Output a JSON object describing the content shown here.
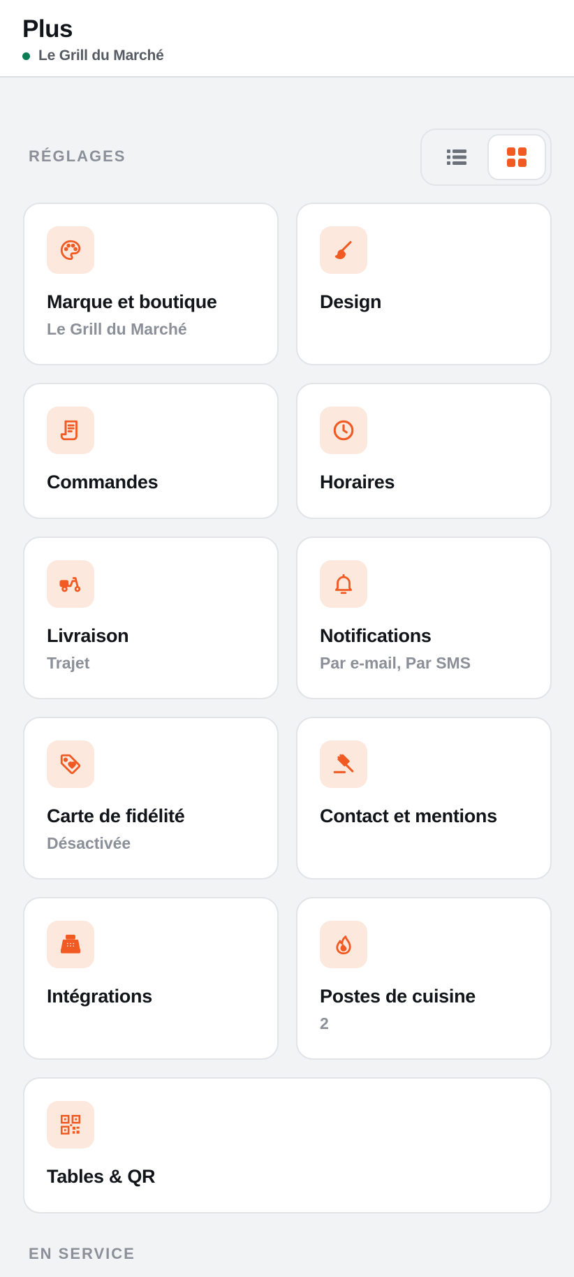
{
  "header": {
    "title": "Plus",
    "store_name": "Le Grill du Marché",
    "status_color": "#0a7d55"
  },
  "sections": {
    "settings_label": "RÉGLAGES",
    "in_service_label": "EN SERVICE"
  },
  "view_toggle": {
    "options": [
      "list",
      "grid"
    ],
    "selected": "grid"
  },
  "accent_color": "#f15a22",
  "icon_bg_color": "#fde8de",
  "cards": [
    {
      "title": "Marque et boutique",
      "subtitle": "Le Grill du Marché",
      "icon": "palette-icon"
    },
    {
      "title": "Design",
      "subtitle": "",
      "icon": "paintbrush-icon"
    },
    {
      "title": "Commandes",
      "subtitle": "",
      "icon": "receipt-icon"
    },
    {
      "title": "Horaires",
      "subtitle": "",
      "icon": "clock-icon"
    },
    {
      "title": "Livraison",
      "subtitle": "Trajet",
      "icon": "scooter-icon"
    },
    {
      "title": "Notifications",
      "subtitle": "Par e-mail, Par SMS",
      "icon": "bell-icon"
    },
    {
      "title": "Carte de fidélité",
      "subtitle": "Désactivée",
      "icon": "tag-heart-icon"
    },
    {
      "title": "Contact et mentions",
      "subtitle": "",
      "icon": "gavel-icon"
    },
    {
      "title": "Intégrations",
      "subtitle": "",
      "icon": "cash-register-icon"
    },
    {
      "title": "Postes de cuisine",
      "subtitle": "2",
      "icon": "flame-icon"
    },
    {
      "title": "Tables & QR",
      "subtitle": "",
      "icon": "qr-code-icon"
    }
  ]
}
